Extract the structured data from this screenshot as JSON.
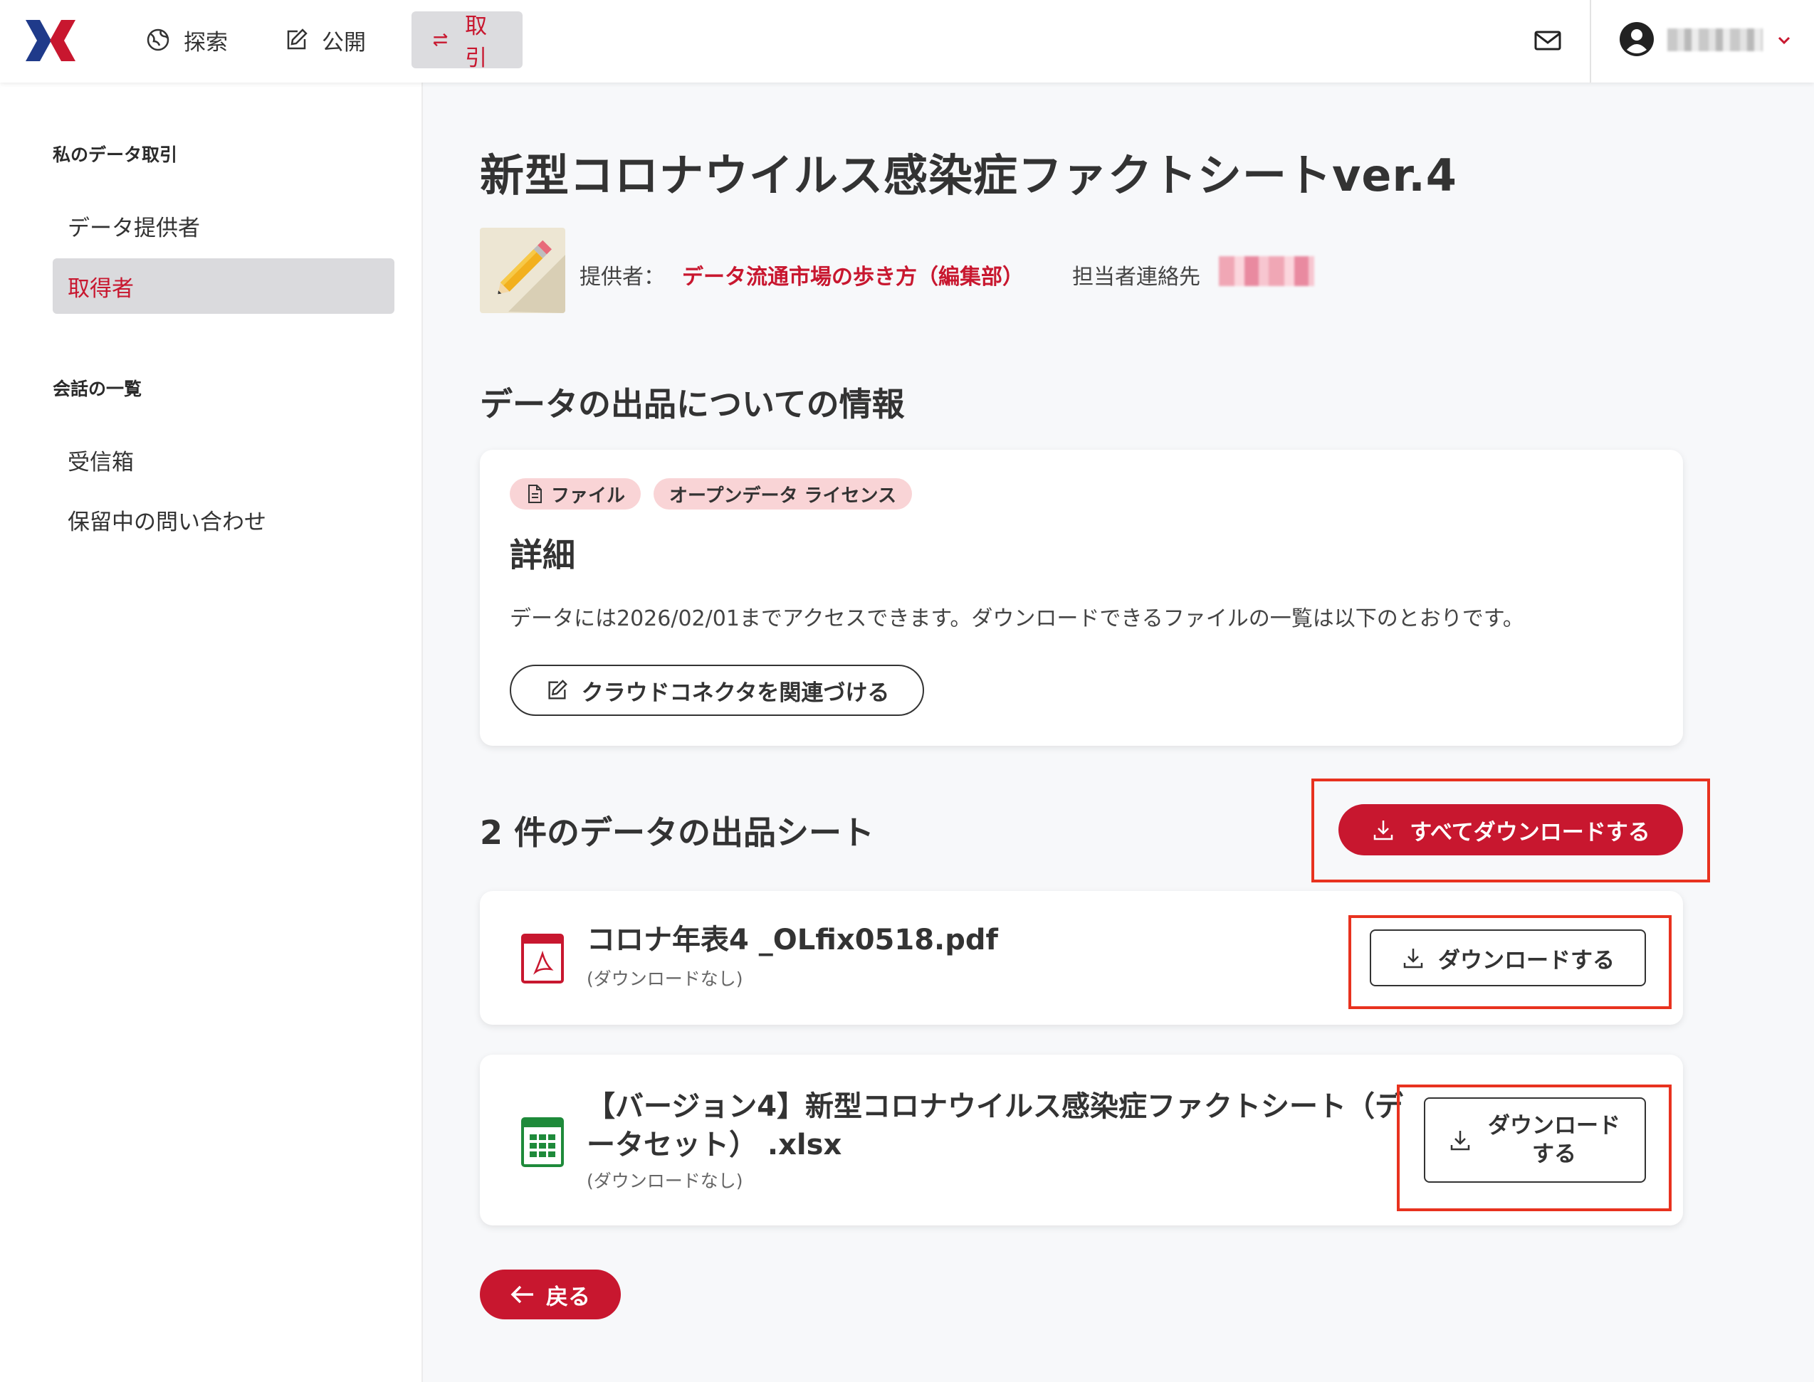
{
  "header": {
    "nav": [
      {
        "label": "探索"
      },
      {
        "label": "公開"
      },
      {
        "label": "取引"
      }
    ],
    "user_name": "■■■ ■■■"
  },
  "sidebar": {
    "section1_title": "私のデータ取引",
    "section1_items": [
      {
        "label": "データ提供者"
      },
      {
        "label": "取得者"
      }
    ],
    "section2_title": "会話の一覧",
    "section2_items": [
      {
        "label": "受信箱"
      },
      {
        "label": "保留中の問い合わせ"
      }
    ]
  },
  "main": {
    "title": "新型コロナウイルス感染症ファクトシートver.4",
    "provider_label": "提供者：",
    "provider_name": "データ流通市場の歩き方（編集部）",
    "contact_label": "担当者連絡先",
    "contact_value": "■■■■■",
    "info_section_title": "データの出品についての情報",
    "info_card": {
      "tag_file": "ファイル",
      "tag_license": "オープンデータ ライセンス",
      "details_title": "詳細",
      "details_text": "データには2026/02/01までアクセスできます。ダウンロードできるファイルの一覧は以下のとおりです。",
      "connector_button": "クラウドコネクタを関連づける"
    },
    "sheets_section_title": "2 件のデータの出品シート",
    "download_all_button": "すべてダウンロードする",
    "files": [
      {
        "name": "コロナ年表4 _OLfix0518.pdf",
        "sub": "(ダウンロードなし)",
        "download_button": "ダウンロードする"
      },
      {
        "name": "【バージョン4】新型コロナウイルス感染症ファクトシート（データセット） .xlsx",
        "sub": "(ダウンロードなし)",
        "download_button": "ダウンロードする"
      }
    ],
    "back_button": "戻る"
  },
  "colors": {
    "accent": "#c8172f",
    "highlight": "#e8321f",
    "tag_bg": "#f9d4d6",
    "background": "#f7f8fa"
  }
}
